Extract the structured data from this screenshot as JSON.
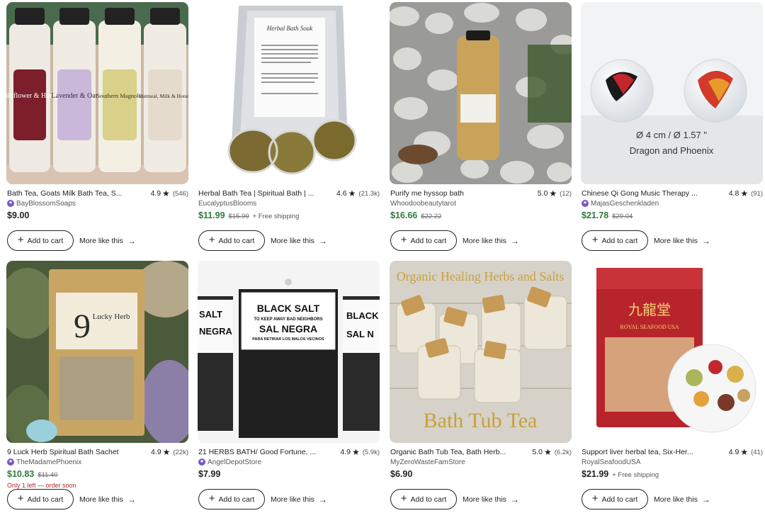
{
  "listings": [
    {
      "title": "Bath Tea, Goats Milk Bath Tea, S...",
      "rating": "4.9",
      "review_count": "(546)",
      "shop": "BayBlossomSoaps",
      "star_seller": true,
      "price": "$9.00",
      "original_price": "",
      "shipping": "",
      "on_sale": false,
      "low_stock": "",
      "image_text": [
        "Wildflower & Honey",
        "Lavender & Oat",
        "Southern Magnolia",
        "Oatmeal, Milk & Honey"
      ]
    },
    {
      "title": "Herbal Bath Tea | Spiritual Bath | ...",
      "rating": "4.6",
      "review_count": "(21.3k)",
      "shop": "EucalyptusBlooms",
      "star_seller": false,
      "price": "$11.99",
      "original_price": "$15.99",
      "shipping": "+ Free shipping",
      "on_sale": true,
      "low_stock": "",
      "image_text": [
        "Herbal Bath Soak"
      ]
    },
    {
      "title": "Purify me hyssop bath",
      "rating": "5.0",
      "review_count": "(12)",
      "shop": "Whoodoobeautytarot",
      "star_seller": false,
      "price": "$16.66",
      "original_price": "$22.22",
      "shipping": "",
      "on_sale": true,
      "low_stock": "",
      "image_text": []
    },
    {
      "title": "Chinese Qi Gong Music Therapy ...",
      "rating": "4.8",
      "review_count": "(91)",
      "shop": "MajasGeschenkladen",
      "star_seller": true,
      "price": "$21.78",
      "original_price": "$29.04",
      "shipping": "",
      "on_sale": true,
      "low_stock": "",
      "image_text": [
        "Ø 4 cm / Ø 1.57 \"",
        "Dragon and Phoenix"
      ]
    },
    {
      "title": "9 Luck Herb Spiritual Bath Sachet",
      "rating": "4.9",
      "review_count": "(22k)",
      "shop": "TheMadamePhoenix",
      "star_seller": true,
      "price": "$10.83",
      "original_price": "$11.40",
      "shipping": "",
      "on_sale": true,
      "low_stock": "Only 1 left — order soon",
      "image_text": [
        "9",
        "Lucky Herb"
      ]
    },
    {
      "title": "21 HERBS BATH/ Good Fortune, ...",
      "rating": "4.9",
      "review_count": "(5.9k)",
      "shop": "AngelDepotStore",
      "star_seller": true,
      "price": "$7.99",
      "original_price": "",
      "shipping": "",
      "on_sale": false,
      "low_stock": "",
      "image_text": [
        "BLACK SALT",
        "TO KEEP AWAY BAD NEIGHBORS",
        "SAL NEGRA",
        "PARA RETIRAR LOS MALOS VECINOS",
        "SALT",
        "NEGRA",
        "BLACK",
        "SAL N"
      ]
    },
    {
      "title": "Organic Bath Tub Tea, Bath Herb...",
      "rating": "5.0",
      "review_count": "(6.2k)",
      "shop": "MyZeroWasteFamStore",
      "star_seller": false,
      "price": "$6.90",
      "original_price": "",
      "shipping": "",
      "on_sale": false,
      "low_stock": "",
      "image_text": [
        "Organic Healing Herbs and Salts",
        "Bath Tub Tea"
      ]
    },
    {
      "title": "Support liver herbal tea, Six-Her...",
      "rating": "4.9",
      "review_count": "(41)",
      "shop": "RoyalSeafoodUSA",
      "star_seller": false,
      "price": "$21.99",
      "original_price": "",
      "shipping": "+ Free shipping",
      "on_sale": false,
      "low_stock": "",
      "image_text": [
        "九龍堂",
        "ROYAL SEAFOOD USA"
      ]
    }
  ],
  "labels": {
    "add_to_cart": "Add to cart",
    "more_like_this": "More like this"
  },
  "icons": {
    "star": "star-icon",
    "plus": "plus-icon",
    "arrow": "arrow-right-icon",
    "star_seller": "star-seller-badge-icon"
  },
  "colors": {
    "sale_price": "#2f7a3b",
    "low_stock": "#b3262d",
    "star_seller": "#7b53c6"
  }
}
